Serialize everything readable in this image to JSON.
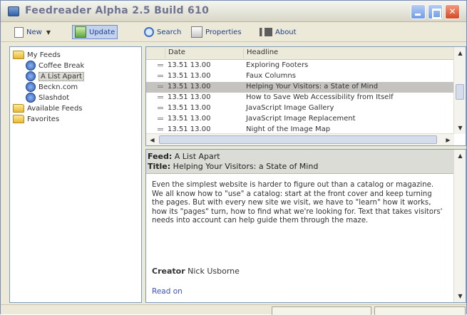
{
  "window": {
    "title": "Feedreader Alpha 2.5 Build 610"
  },
  "toolbar": {
    "new_label": "New",
    "update_label": "Update",
    "search_label": "Search",
    "properties_label": "Properties",
    "about_label": "About"
  },
  "tree": {
    "root_label": "My Feeds",
    "feeds": [
      "Coffee Break",
      "A List Apart",
      "Beckn.com",
      "Slashdot"
    ],
    "available_label": "Available Feeds",
    "favorites_label": "Favorites"
  },
  "list": {
    "columns": [
      "Date",
      "Headline"
    ],
    "rows": [
      {
        "date": "13.51 13.00",
        "headline": "Exploring Footers"
      },
      {
        "date": "13.51 13.00",
        "headline": "Faux Columns"
      },
      {
        "date": "13.51 13.00",
        "headline": "Helping Your Visitors: a State of Mind"
      },
      {
        "date": "13.51 13.00",
        "headline": "How to Save Web Accessibility from Itself"
      },
      {
        "date": "13.51 13.00",
        "headline": "JavaScript Image Gallery"
      },
      {
        "date": "13.51 13.00",
        "headline": "JavaScript Image Replacement"
      },
      {
        "date": "13.51 13.00",
        "headline": "Night of the Image Map"
      }
    ]
  },
  "detail": {
    "feed_label": "Feed:",
    "feed_value": "A List Apart",
    "title_label": "Title:",
    "title_value": "Helping Your Visitors: a State of Mind",
    "body": "Even the simplest website is harder to figure out than a catalog or magazine. We all know how to \"use\" a catalog: start at the front cover and keep turning the pages. But with every new site we visit, we have to \"learn\" how it works, how its \"pages\" turn, how to find what we're looking for. Text that takes visitors' needs into account can help guide them through the maze.",
    "creator_label": "Creator",
    "creator_value": "Nick Usborne",
    "read_on": "Read on"
  }
}
